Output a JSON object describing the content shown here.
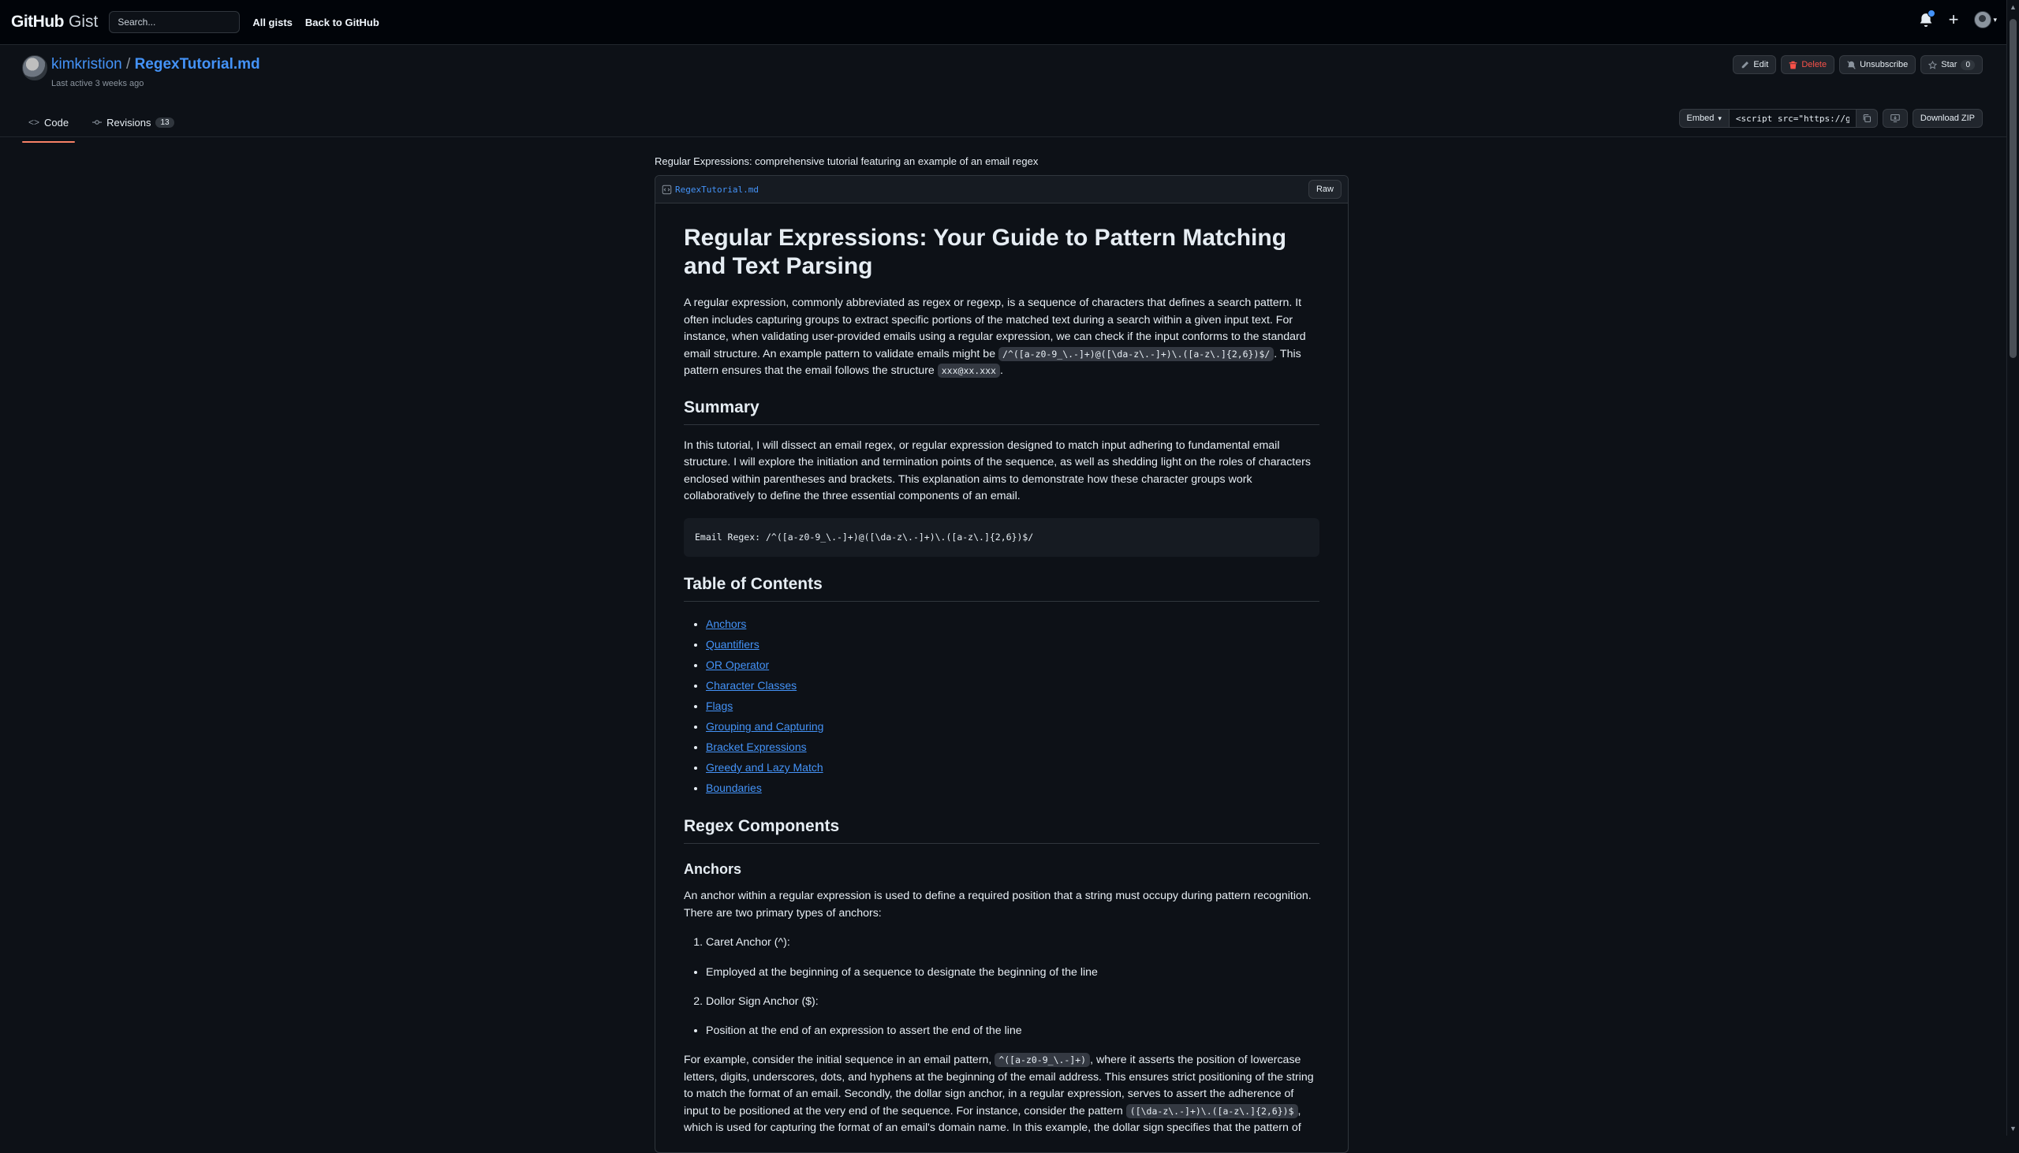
{
  "header": {
    "logo_main": "GitHub",
    "logo_sub": "Gist",
    "search_placeholder": "Search...",
    "links": [
      "All gists",
      "Back to GitHub"
    ]
  },
  "gist": {
    "owner": "kimkristion",
    "separator": "/",
    "filename": "RegexTutorial.md",
    "meta": "Last active 3 weeks ago",
    "actions": {
      "edit": "Edit",
      "delete": "Delete",
      "unsubscribe": "Unsubscribe",
      "star": "Star",
      "star_count": "0"
    },
    "tabs": {
      "code": "Code",
      "revisions": "Revisions",
      "revisions_count": "13"
    },
    "embed": {
      "label": "Embed",
      "value": "<script src=\"https://gist.github.com/kimkristion",
      "download": "Download ZIP"
    },
    "description": "Regular Expressions: comprehensive tutorial featuring an example of an email regex",
    "file": {
      "name": "RegexTutorial.md",
      "raw": "Raw"
    }
  },
  "markdown": {
    "h1": "Regular Expressions: Your Guide to Pattern Matching and Text Parsing",
    "intro_1": "A regular expression, commonly abbreviated as regex or regexp, is a sequence of characters that defines a search pattern. It often includes capturing groups to extract specific portions of the matched text during a search within a given input text. For instance, when validating user-provided emails using a regular expression, we can check if the input conforms to the standard email structure. An example pattern to validate emails might be ",
    "intro_code_1": "/^([a-z0-9_\\.-]+)@([\\da-z\\.-]+)\\.([a-z\\.]{2,6})$/",
    "intro_2": ". This pattern ensures that the email follows the structure ",
    "intro_code_2": "xxx@xx.xxx",
    "intro_3": ".",
    "summary_h": "Summary",
    "summary_p": "In this tutorial, I will dissect an email regex, or regular expression designed to match input adhering to fundamental email structure. I will explore the initiation and termination points of the sequence, as well as shedding light on the roles of characters enclosed within parentheses and brackets. This explanation aims to demonstrate how these character groups work collaboratively to define the three essential components of an email.",
    "code_block": "Email Regex: /^([a-z0-9_\\.-]+)@([\\da-z\\.-]+)\\.([a-z\\.]{2,6})$/",
    "toc_h": "Table of Contents",
    "toc": [
      "Anchors",
      "Quantifiers",
      "OR Operator",
      "Character Classes",
      "Flags",
      "Grouping and Capturing",
      "Bracket Expressions",
      "Greedy and Lazy Match",
      "Boundaries"
    ],
    "components_h": "Regex Components",
    "anchors_h": "Anchors",
    "anchors_p": "An anchor within a regular expression is used to define a required position that a string must occupy during pattern recognition. There are two primary types of anchors:",
    "caret_item": "Caret Anchor (^):",
    "caret_desc": "Employed at the beginning of a sequence to designate the beginning of the line",
    "dollar_item": "Dollor Sign Anchor ($):",
    "dollar_desc": "Position at the end of an expression to assert the end of the line",
    "example_1": "For example, consider the initial sequence in an email pattern, ",
    "example_code_1": "^([a-z0-9_\\.-]+)",
    "example_2": ", where it asserts the position of lowercase letters, digits, underscores, dots, and hyphens at the beginning of the email address. This ensures strict positioning of the string to match the format of an email. Secondly, the dollar sign anchor, in a regular expression, serves to assert the adherence of input to be positioned at the very end of the sequence. For instance, consider the pattern ",
    "example_code_2": "([\\da-z\\.-]+)\\.([a-z\\.]{2,6})$",
    "example_3": ", which is used for capturing the format of an email's domain name. In this example, the dollar sign specifies that the pattern of"
  },
  "colors": {
    "background": "#0d1117",
    "header": "#010409",
    "link": "#4493f8",
    "danger": "#f85149",
    "active_tab": "#f78166"
  }
}
